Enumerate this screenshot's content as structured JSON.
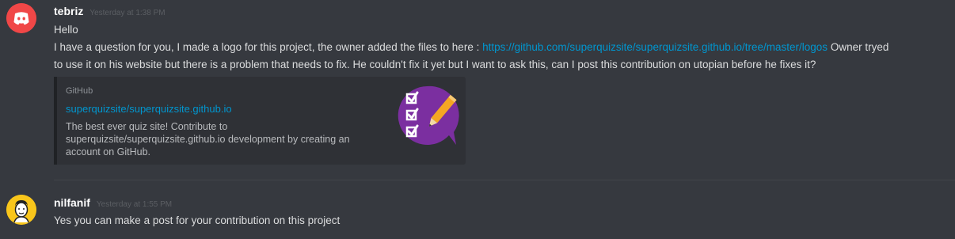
{
  "messages": [
    {
      "author": "tebriz",
      "timestamp": "Yesterday at 1:38 PM",
      "avatar_icon": "discord-logo-icon",
      "lines": [
        "Hello",
        "I have a question for you, I made  a logo for this project, the owner added the files to here : ",
        "Owner tryed",
        "to use it on his website but there is a problem that needs to fix. He couldn't fix it yet but I want to ask this, can I post this contribution on utopian before he fixes it?"
      ],
      "link": "https://github.com/superquizsite/superquizsite.github.io/tree/master/logos",
      "embed": {
        "provider": "GitHub",
        "title": "superquizsite/superquizsite.github.io",
        "description": "The best ever quiz site! Contribute to superquizsite/superquizsite.github.io development by creating an account on GitHub.",
        "thumbnail_icon": "quiz-checklist-pencil-logo-icon"
      }
    },
    {
      "author": "nilfanif",
      "timestamp": "Yesterday at 1:55 PM",
      "avatar_icon": "cartoon-face-avatar-icon",
      "lines": [
        "Yes you can make a post for your contribution on this project"
      ]
    }
  ],
  "colors": {
    "background": "#36393f",
    "link": "#0096cf",
    "avatar1": "#f04747",
    "avatar2": "#f9c61b",
    "thumbnail": "#7b2fa0"
  }
}
